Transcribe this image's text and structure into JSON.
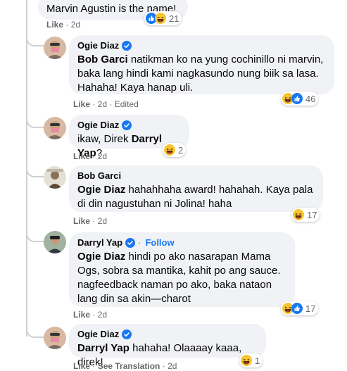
{
  "comments": [
    {
      "body": "Marvin Agustin is the name!",
      "reactions": "21",
      "like": "Like",
      "time": "2d"
    },
    {
      "author": "Ogie Diaz",
      "mention": "Bob Garci",
      "body": " natikman ko na yung cochinillo ni marvin, baka lang hindi kami nagkasundo nung biik sa lasa. Hahaha! Kaya hanap uli.",
      "reactions": "46",
      "like": "Like",
      "time": "2d",
      "edited": "Edited"
    },
    {
      "author": "Ogie Diaz",
      "prefix": "ikaw, Direk ",
      "mention": "Darryl Yap",
      "suffix": "?",
      "reactions": "2",
      "like": "Like",
      "time": "2d"
    },
    {
      "author": "Bob Garci",
      "mention": "Ogie Diaz",
      "body": " hahahhaha award! hahahah. Kaya pala di din nagustuhan ni Jolina! haha",
      "reactions": "17",
      "like": "Like",
      "time": "2d"
    },
    {
      "author": "Darryl Yap",
      "follow": "Follow",
      "mention": "Ogie Diaz",
      "body": " hindi po ako nasarapan Mama Ogs, sobra sa mantika, kahit po ang sauce. nagfeedback naman po ako, baka nataon lang din sa akin—charot",
      "reactions": "17",
      "like": "Like",
      "time": "2d"
    },
    {
      "author": "Ogie Diaz",
      "mention": "Darryl Yap",
      "body": " hahaha! Olaaaay kaaa, direk!",
      "reactions": "1",
      "like": "Like",
      "see_translation": "See Translation",
      "time": "2d"
    }
  ],
  "sep": " · "
}
